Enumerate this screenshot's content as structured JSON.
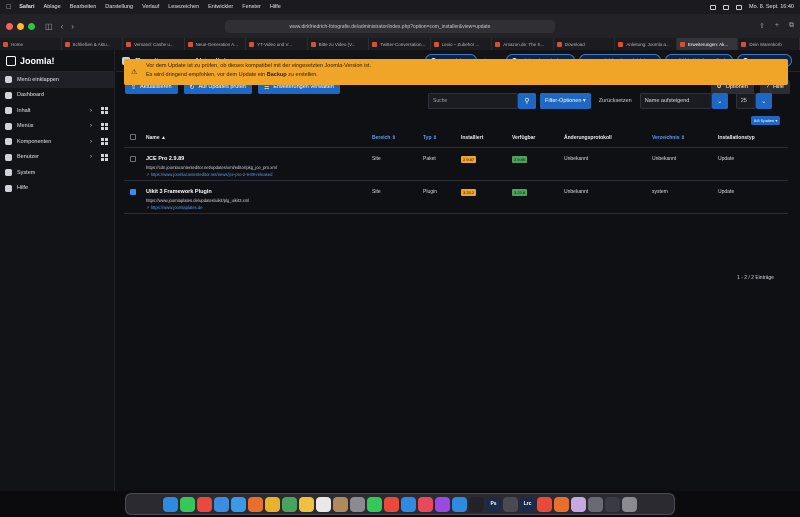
{
  "menubar": {
    "items": [
      "Safari",
      "Ablage",
      "Bearbeiten",
      "Darstellung",
      "Verlauf",
      "Lesezeichen",
      "Entwickler",
      "Fenster",
      "Hilfe"
    ],
    "clock": "Mo. 8. Sept. 16:40"
  },
  "browser": {
    "url": "www.dirkfriedrich-fotografie.de/administrator/index.php?option=com_installer&view=update"
  },
  "tabs": [
    "Home",
    "Schließen & Aktu...",
    "Versand: Cashe u...",
    "Neue-Generation A...",
    "YT-Video und V...",
    "Bitte zu Video (V...",
    "Twitter-Conversation...",
    "Lexio – Zubehör ...",
    "Amazon.de: The S...",
    "Download",
    "Anleitung: Joomla a...",
    "Erweiterungen: Ak...",
    "Dein Warenkorb"
  ],
  "sidebar": {
    "brand": "Joomla!",
    "items": [
      {
        "label": "Menü einklappen"
      },
      {
        "label": "Dashboard"
      },
      {
        "label": "Inhalt"
      },
      {
        "label": "Menüs"
      },
      {
        "label": "Komponenten"
      },
      {
        "label": "Benutzer"
      },
      {
        "label": "System"
      },
      {
        "label": "Hilfe"
      }
    ]
  },
  "header": {
    "title": "Erweiterungen: Aktualisieren",
    "buttons": {
      "steps": "Erste Schritte",
      "version": "5.3.2",
      "cache": "Admintool: Cache leeren",
      "notifications_count": "5",
      "notifications": "Nachrichtenbenachrichtigung",
      "site": "dirkfriedrich-fotografie.de",
      "user": "Benutzermenü"
    }
  },
  "toolbar": {
    "update": "Aktualisieren",
    "check": "Auf Updates prüfen",
    "manage": "Erweiterungen verwalten",
    "options": "Optionen",
    "help": "Hilfe"
  },
  "alert": {
    "line1": "Vor dem Update ist zu prüfen, ob dieses kompatibel mit der eingesetzten Joomla-Version ist.",
    "line2_pre": "Es wird dringend empfohlen, vor dem Update ein ",
    "line2_bold": "Backup",
    "line2_post": " zu erstellen."
  },
  "filters": {
    "search_placeholder": "Suche",
    "filter_options": "Filter-Optionen",
    "reset": "Zurücksetzen",
    "sort": "Name aufsteigend",
    "limit": "25",
    "columns": "8/8 Spalten"
  },
  "table": {
    "headers": {
      "name": "Name",
      "area": "Bereich",
      "type": "Typ",
      "installed": "Installiert",
      "available": "Verfügbar",
      "changelog": "Änderungsprotokoll",
      "folder": "Verzeichnis",
      "install_type": "Installationstyp"
    },
    "rows": [
      {
        "name": "JCE Pro 2.9.89",
        "url": "https://cdn.joomlacontenteditor.net/updates/xml/editor/pkg_jce_pro.xml",
        "link": "https://www.joomlacontenteditor.net/news/jce-pro-2-9-89-released",
        "area": "Site",
        "type": "Paket",
        "installed": "2.9.87",
        "available": "2.9.89",
        "changelog": "Unbekannt",
        "folder": "Unbekannt",
        "install_type": "Update"
      },
      {
        "name": "Uikit 3 Framework Plugin",
        "url": "https://www.joomlaplates.de/updates/uikit/plg_uikit3.xml",
        "link": "https://www.joomlaplates.de",
        "area": "Site",
        "type": "Plugin",
        "installed": "3.23.2",
        "available": "3.23.8",
        "changelog": "Unbekannt",
        "folder": "system",
        "install_type": "Update"
      }
    ],
    "count": "1 - 2 / 2 Einträge"
  },
  "colors": {
    "accent": "#1e68c4",
    "warning": "#f0a428",
    "success": "#4aa35a"
  },
  "dock": {
    "apps": [
      {
        "icon": "finder-icon",
        "color": "#2f8ae0",
        "label": ""
      },
      {
        "icon": "messages-icon",
        "color": "#35c759",
        "label": ""
      },
      {
        "icon": "calendar-icon",
        "color": "#e84a3c",
        "label": ""
      },
      {
        "icon": "mail-icon",
        "color": "#3a8de0",
        "label": ""
      },
      {
        "icon": "safari-icon",
        "color": "#3a9ae8",
        "label": ""
      },
      {
        "icon": "firefox-icon",
        "color": "#e8702c",
        "label": ""
      },
      {
        "icon": "photos-icon",
        "color": "#e8b22c",
        "label": ""
      },
      {
        "icon": "maps-icon",
        "color": "#4aa35a",
        "label": ""
      },
      {
        "icon": "notes-icon",
        "color": "#f0c040",
        "label": ""
      },
      {
        "icon": "reminders-icon",
        "color": "#e8e8e8",
        "label": ""
      },
      {
        "icon": "contacts-icon",
        "color": "#b08a5c",
        "label": ""
      },
      {
        "icon": "settings-icon",
        "color": "#8a8a90",
        "label": ""
      },
      {
        "icon": "facetime-icon",
        "color": "#35c759",
        "label": ""
      },
      {
        "icon": "chrome-icon",
        "color": "#e84a3c",
        "label": ""
      },
      {
        "icon": "vscode-icon",
        "color": "#2f8ae0",
        "label": ""
      },
      {
        "icon": "music-icon",
        "color": "#e84a5c",
        "label": ""
      },
      {
        "icon": "podcasts-icon",
        "color": "#9a4ae0",
        "label": ""
      },
      {
        "icon": "appstore-icon",
        "color": "#2f8ae0",
        "label": ""
      },
      {
        "icon": "capcut-icon",
        "color": "#222228",
        "label": ""
      },
      {
        "icon": "photoshop-icon",
        "color": "#1b2a4a",
        "label": "Ps"
      },
      {
        "icon": "app-icon",
        "color": "#4a4a52",
        "label": ""
      },
      {
        "icon": "lightroom-icon",
        "color": "#1b2a4a",
        "label": "Lrc"
      },
      {
        "icon": "davinci-icon",
        "color": "#e84a3c",
        "label": ""
      },
      {
        "icon": "firefox2-icon",
        "color": "#e8702c",
        "label": ""
      },
      {
        "icon": "preview-icon",
        "color": "#c8a8e0",
        "label": ""
      },
      {
        "icon": "finder2-icon",
        "color": "#6a6a72",
        "label": ""
      },
      {
        "icon": "downloads-icon",
        "color": "#3a3a42",
        "label": ""
      },
      {
        "icon": "trash-icon",
        "color": "#8a8a90",
        "label": ""
      }
    ]
  }
}
